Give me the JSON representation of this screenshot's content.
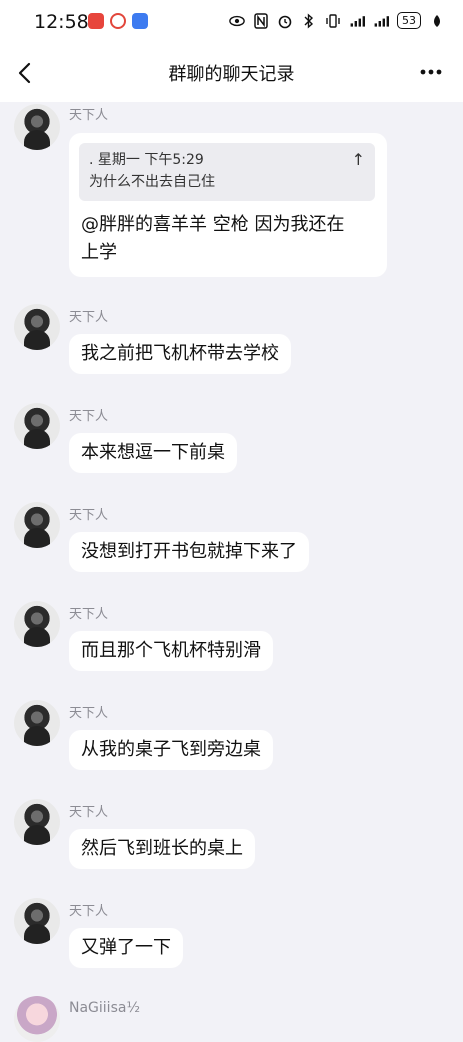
{
  "status_bar": {
    "time": "12:58",
    "battery": "53"
  },
  "header": {
    "title": "群聊的聊天记录"
  },
  "quote": {
    "meta": ". 星期一 下午5:29",
    "text": "为什么不出去自己住",
    "up_icon": "↑"
  },
  "messages": [
    {
      "sender": "天下人",
      "text_line1": "@胖胖的喜羊羊 空枪 因为我还在",
      "text_line2": "上学"
    },
    {
      "sender": "天下人",
      "text": "我之前把飞机杯带去学校"
    },
    {
      "sender": "天下人",
      "text": "本来想逗一下前桌"
    },
    {
      "sender": "天下人",
      "text": "没想到打开书包就掉下来了"
    },
    {
      "sender": "天下人",
      "text": "而且那个飞机杯特别滑"
    },
    {
      "sender": "天下人",
      "text": "从我的桌子飞到旁边桌"
    },
    {
      "sender": "天下人",
      "text": "然后飞到班长的桌上"
    },
    {
      "sender": "天下人",
      "text": "又弹了一下"
    }
  ],
  "last_sender": "NaGiiisa½"
}
